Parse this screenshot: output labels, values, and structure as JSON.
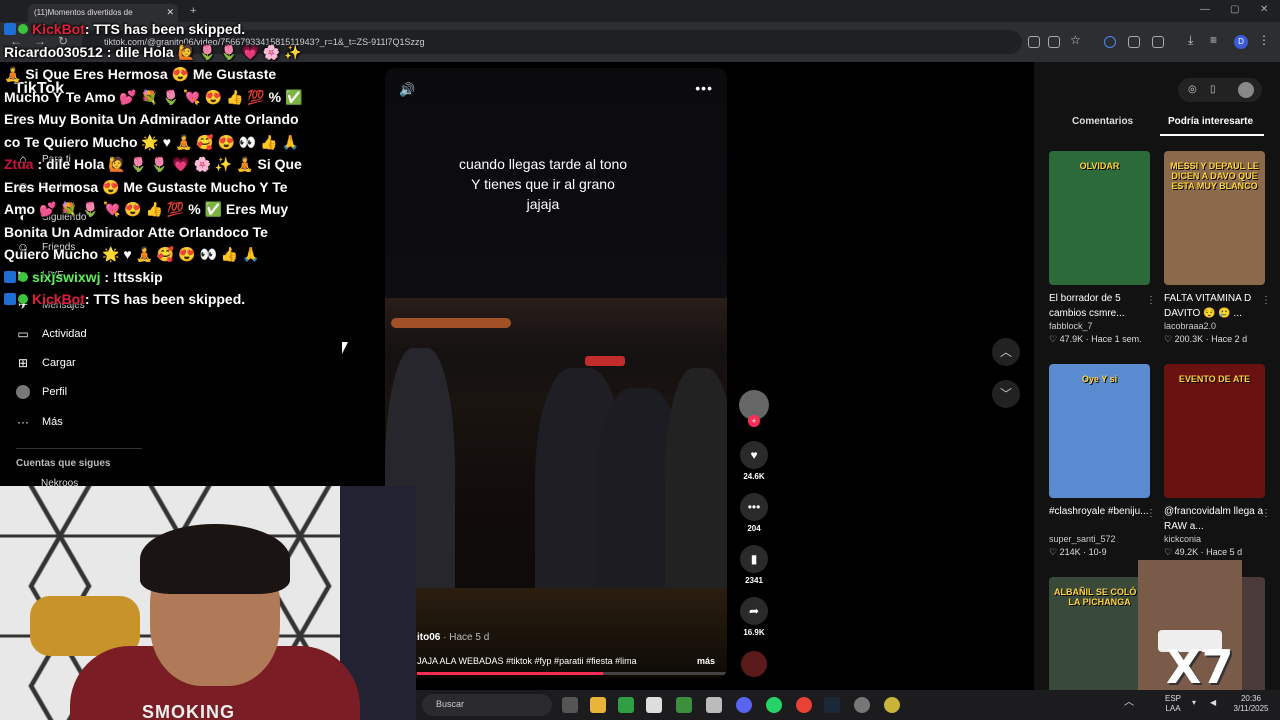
{
  "browser": {
    "tab_title": "(11)Momentos divertidos de",
    "url": "tiktok.com/@granito06/video/7566793341581511943?_r=1&_t=ZS-911l7Q1Szzg"
  },
  "sidebar": {
    "logo": "TikTok",
    "items": [
      {
        "label": "Para ti",
        "icon": "home-icon"
      },
      {
        "label": "Explorar",
        "icon": "compass-icon"
      },
      {
        "label": "Siguiendo",
        "icon": "following-icon"
      },
      {
        "label": "Friends",
        "icon": "friends-icon"
      },
      {
        "label": "LIVE",
        "icon": "live-icon"
      },
      {
        "label": "Mensajes",
        "icon": "message-icon"
      },
      {
        "label": "Actividad",
        "icon": "activity-icon"
      },
      {
        "label": "Cargar",
        "icon": "upload-icon"
      },
      {
        "label": "Perfil",
        "icon": "profile-icon"
      },
      {
        "label": "Más",
        "icon": "more-icon"
      }
    ],
    "following_title": "Cuentas que sigues",
    "following_user": "Nekroos"
  },
  "chat": {
    "line1_user": "KickBot",
    "line1_text": ": TTS has been skipped.",
    "line2_user": "Ricardo030512",
    "line2_text": ": dile Hola 🙋 🌷 🌷 💗 🌸 ✨",
    "line3": "🧘 Si Que Eres Hermosa 😍 Me Gustaste Mucho Y Te Amo 💕 💐 🌷 💘 😍 👍 💯 % ✅",
    "line4": "Eres Muy Bonita Un Admirador Atte Orlando co Te Quiero Mucho 🌟 ♥ 🧘 🥰 😍 👀 👍 🙏",
    "line5_user": "Ztua",
    "line5_text": ": dile Hola 🙋 🌷 🌷 💗 🌸 ✨ 🧘 Si Que Eres Hermosa 😍 Me Gustaste Mucho Y Te Amo 💕 💐 🌷 💘 😍 👍 💯 % ✅ Eres Muy Bonita Un Admirador Atte Orlandoco Te Quiero Mucho 🌟 ♥ 🧘 🥰 😍 👀 👍 🙏",
    "line6_user": "sixjswixwj",
    "line6_text": ": !ttsskip",
    "line7_user": "KickBot",
    "line7_text": ": TTS has been skipped."
  },
  "video": {
    "caption": "cuando llegas tarde al tono Y tienes que ir al grano jajaja",
    "author": "ito06",
    "time": "· Hace 5 d",
    "description": "JAJA ALA WEBADAS #tiktok #fyp #paratii #fiesta #lima",
    "more": "más",
    "progress": 0.6
  },
  "actions": {
    "likes": "24.6K",
    "comments": "204",
    "saves": "2341",
    "shares": "16.9K"
  },
  "right_panel": {
    "tab_comments": "Comentarios",
    "tab_interesting": "Podría interesarte",
    "cards": [
      {
        "title": "El borrador de 5 cambios csmre...",
        "user": "fabblock_7",
        "likes": "47.9K",
        "time": "Hace 1 sem.",
        "thumb_color": "#2d6a3a",
        "thumb_text": "OLVIDAR"
      },
      {
        "title": "FALTA VITAMINA D DAVITO 😌 🥲 ...",
        "user": "lacobraaa2.0",
        "likes": "200.3K",
        "time": "Hace 2 d",
        "thumb_color": "#8a6a4a",
        "thumb_text": "MESSI Y DEPAUL LE DICEN A DAVO QUE ESTA MUY BLANCO"
      },
      {
        "title": "#clashroyale #beniju...",
        "user": "super_santi_572",
        "likes": "214K",
        "time": "10-9",
        "thumb_color": "#5a8ad0",
        "thumb_text": "Oye Y si"
      },
      {
        "title": "@francovidalm llega a RAW a...",
        "user": "kickconia",
        "likes": "49.2K",
        "time": "Hace 5 d",
        "thumb_color": "#6a1212",
        "thumb_text": "EVENTO DE ATE"
      },
      {
        "title": "",
        "user": "",
        "likes": "",
        "time": "",
        "thumb_color": "#3a4a3a",
        "thumb_text": "ALBAÑIL SE COLÓ A LA PICHANGA"
      },
      {
        "title": "",
        "user": "",
        "likes": "",
        "time": "",
        "thumb_color": "#4a3a3a",
        "thumb_text": ""
      }
    ]
  },
  "taskbar": {
    "search_placeholder": "Buscar",
    "lang": "ESP LAA",
    "time": "20:36",
    "date": "3/11/2025"
  },
  "meme": {
    "text": "X7"
  },
  "webcam": {
    "shirt_text": "SMOKING"
  },
  "colors": {
    "accent": "#fe2c55",
    "chat_red": "#e0203a",
    "chat_green": "#5ef05e"
  }
}
